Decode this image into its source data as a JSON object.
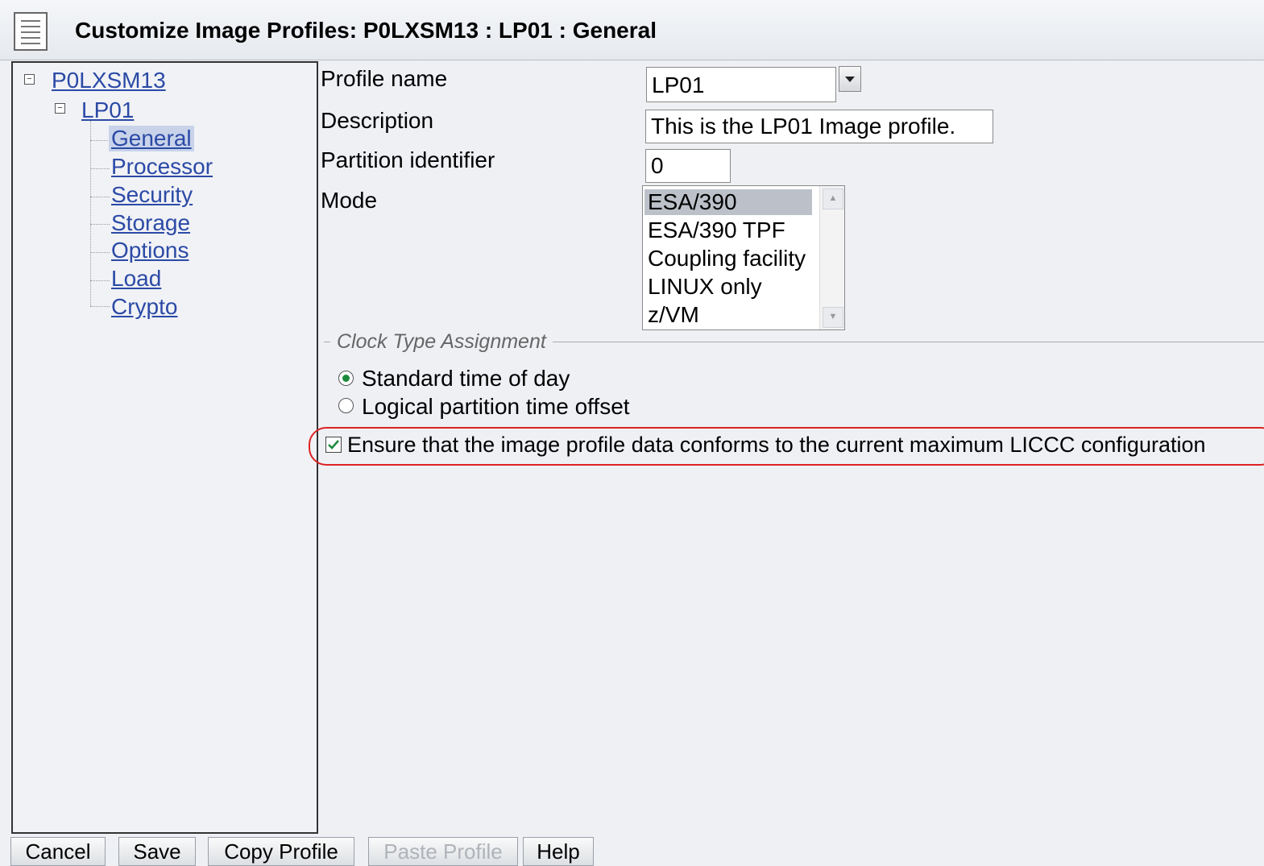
{
  "window": {
    "title": "Customize Image Profiles: P0LXSM13 : LP01 : General",
    "icon": "document-icon"
  },
  "tree": {
    "root": "P0LXSM13",
    "child": "LP01",
    "items": [
      "General",
      "Processor",
      "Security",
      "Storage",
      "Options",
      "Load",
      "Crypto"
    ],
    "selected": "General"
  },
  "form": {
    "profile_name_label": "Profile name",
    "profile_name_value": "LP01",
    "description_label": "Description",
    "description_value": "This is the LP01 Image profile.",
    "partition_id_label": "Partition identifier",
    "partition_id_value": "0",
    "mode_label": "Mode",
    "mode_options": [
      "ESA/390",
      "ESA/390 TPF",
      "Coupling facility",
      "LINUX only",
      "z/VM"
    ],
    "mode_selected": "ESA/390"
  },
  "clock": {
    "legend": "Clock Type Assignment",
    "option1": "Standard time of day",
    "option2": "Logical partition time offset",
    "selected": "Standard time of day"
  },
  "liccc": {
    "label": "Ensure that the image profile data conforms to the current maximum LICCC configuration",
    "checked": true
  },
  "buttons": {
    "cancel": "Cancel",
    "save": "Save",
    "copy": "Copy Profile",
    "paste": "Paste Profile",
    "help": "Help"
  },
  "colors": {
    "link": "#2b4aa6",
    "selected_bg": "#c8d3ea",
    "highlight": "#dd2222",
    "radio": "#1c8a3c"
  }
}
